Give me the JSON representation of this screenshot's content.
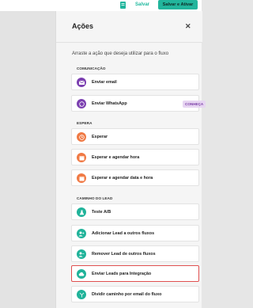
{
  "topbar": {
    "save_label": "Salvar",
    "save_activate_label": "Salvar e Ativar"
  },
  "panel": {
    "title": "Ações",
    "description": "Arraste a ação que deseja utilizar para o fluxo"
  },
  "sections": {
    "comunicacao": {
      "label": "COMUNICAÇÃO",
      "items": [
        {
          "label": "Enviar email",
          "icon": "email-icon"
        },
        {
          "label": "Enviar WhatsApp",
          "icon": "whatsapp-icon",
          "badge": "CONHEÇA"
        }
      ]
    },
    "espera": {
      "label": "ESPERA",
      "items": [
        {
          "label": "Esperar",
          "icon": "clock-icon"
        },
        {
          "label": "Esperar e agendar hora",
          "icon": "calendar-icon"
        },
        {
          "label": "Esperar e agendar data e hora",
          "icon": "calendar-icon"
        }
      ]
    },
    "caminho": {
      "label": "CAMINHO DO LEAD",
      "items": [
        {
          "label": "Teste A/B",
          "icon": "flask-icon"
        },
        {
          "label": "Adicionar Lead a outros fluxos",
          "icon": "add-user-icon"
        },
        {
          "label": "Remover Lead de outros fluxos",
          "icon": "remove-user-icon"
        },
        {
          "label": "Enviar Leads para Integração",
          "icon": "cloud-icon"
        },
        {
          "label": "Dividir caminho por email do fluxo",
          "icon": "split-icon"
        }
      ]
    }
  },
  "colors": {
    "accent": "#22b59c",
    "purple": "#7b3fb0",
    "orange": "#f07a45",
    "highlight_border": "#e05050"
  }
}
